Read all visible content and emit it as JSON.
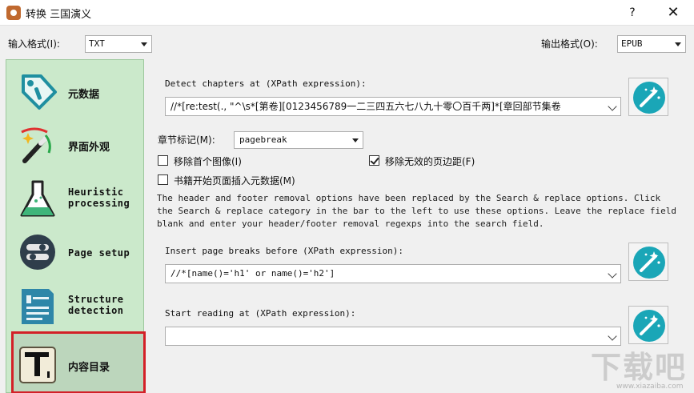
{
  "window": {
    "title": "转换 三国演义",
    "help_label": "?",
    "close_label": "✕"
  },
  "formats": {
    "input_label": "输入格式(I):",
    "input_value": "TXT",
    "output_label": "输出格式(O):",
    "output_value": "EPUB"
  },
  "sidebar": {
    "items": [
      {
        "label": "元数据",
        "icon": "tag-icon"
      },
      {
        "label": "界面外观",
        "icon": "magic-wand-icon"
      },
      {
        "label_line1": "Heuristic",
        "label_line2": "processing",
        "icon": "flask-icon"
      },
      {
        "label": "Page setup",
        "icon": "toggle-icon"
      },
      {
        "label_line1": "Structure",
        "label_line2": "detection",
        "icon": "document-icon"
      },
      {
        "label": "内容目录",
        "icon": "text-t-icon"
      }
    ],
    "selected_index": 4,
    "selection_color": "#d32027"
  },
  "structure": {
    "detect_label": "Detect chapters at (XPath expression):",
    "detect_value": "//*[re:test(., \"^\\s*[第卷][0123456789一二三四五六七八九十零〇百千两]*[章回部节集卷",
    "chapter_mark_label": "章节标记(M):",
    "chapter_mark_value": "pagebreak",
    "remove_first_image_label": "移除首个图像(I)",
    "remove_first_image_checked": false,
    "remove_fake_margins_label": "移除无效的页边距(F)",
    "remove_fake_margins_checked": true,
    "insert_metadata_label": "书籍开始页面插入元数据(M)",
    "insert_metadata_checked": false,
    "info_text": "The header and footer removal options have been replaced by the Search & replace options. Click the Search & replace category in the bar to the left to use these options. Leave the replace field blank and enter your header/footer removal regexps into the search field.",
    "page_breaks_label": "Insert page breaks before (XPath expression):",
    "page_breaks_value": "//*[name()='h1' or name()='h2']",
    "start_reading_label": "Start reading at (XPath expression):",
    "start_reading_value": ""
  },
  "watermark": {
    "text": "下载吧",
    "url": "www.xiazaiba.com"
  },
  "colors": {
    "sidebar_bg": "#cbe9cb",
    "wand_teal": "#1aa6b7"
  }
}
